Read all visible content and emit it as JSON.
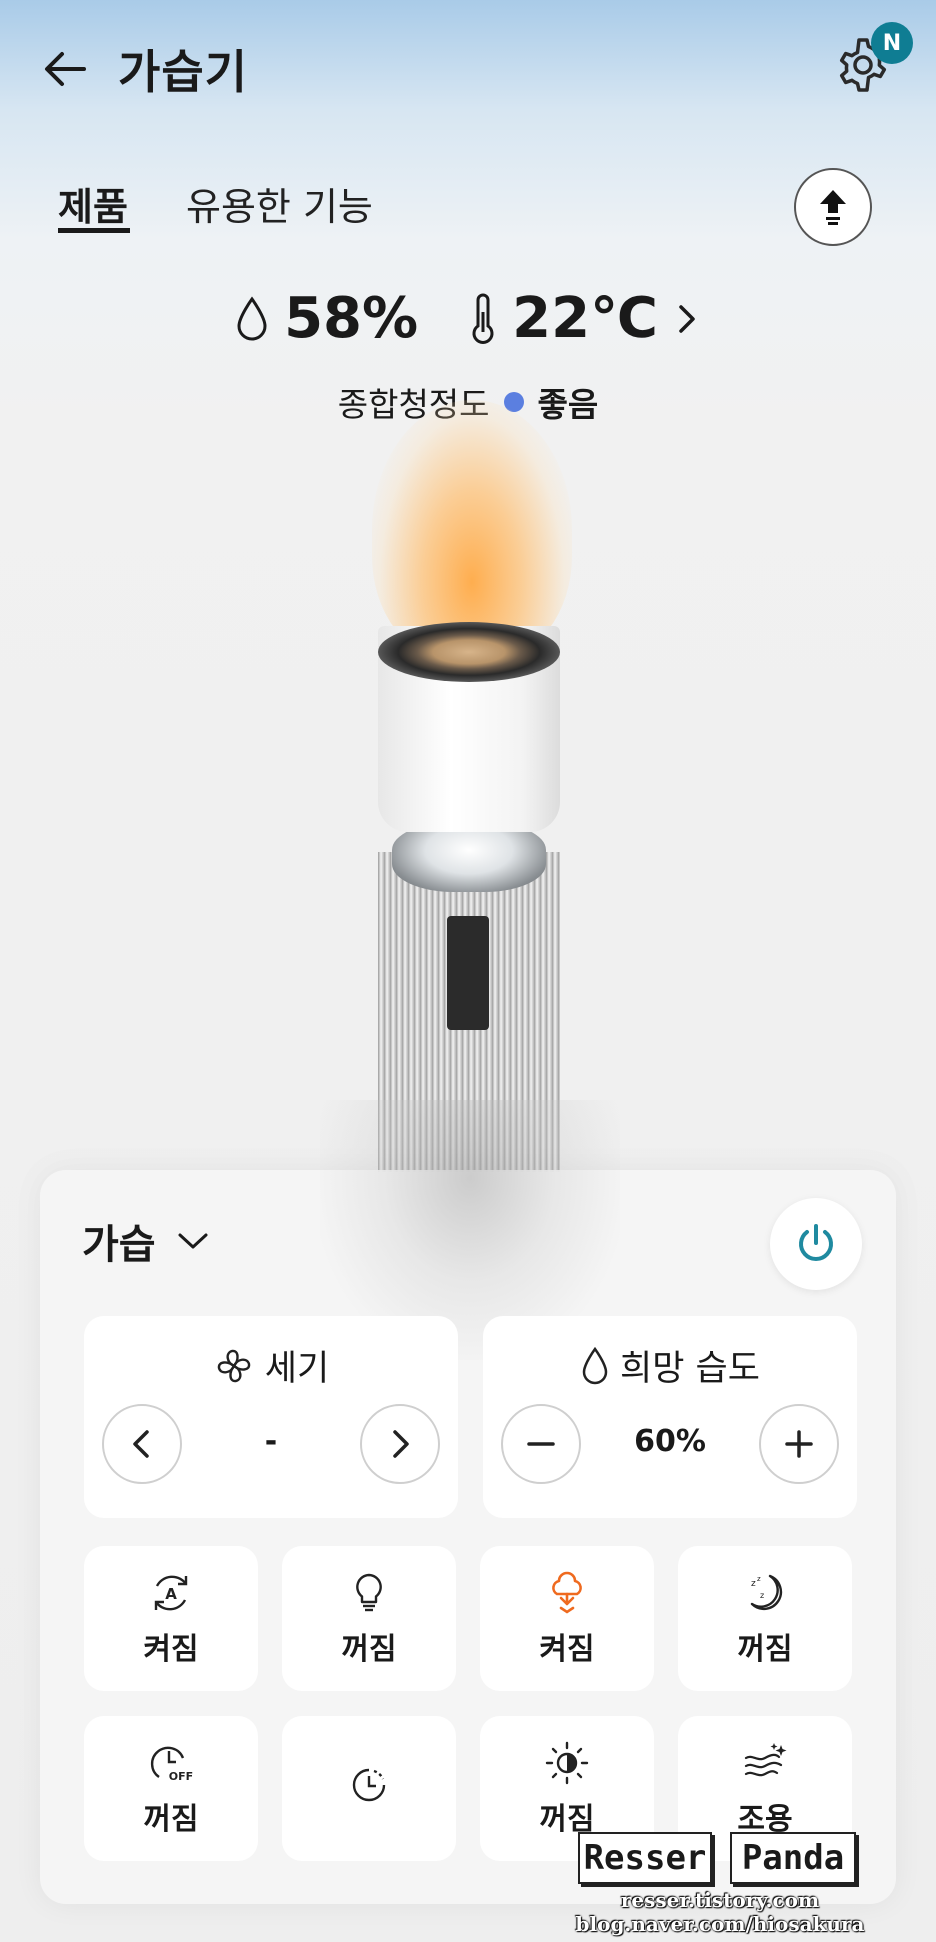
{
  "header": {
    "title": "가습기",
    "badge": "N"
  },
  "tabs": [
    {
      "label": "제품"
    },
    {
      "label": "유용한 기능"
    }
  ],
  "status": {
    "humidity": "58%",
    "temperature": "22℃",
    "air_quality_label": "종합청정도",
    "air_quality_value": "좋음",
    "air_quality_color": "#5b7fe0"
  },
  "panel": {
    "mode": "가습",
    "fan": {
      "label": "세기",
      "value": "-"
    },
    "target_humidity": {
      "label": "희망 습도",
      "value": "60%"
    },
    "tiles": [
      {
        "icon": "auto-mode-icon",
        "label": "켜짐"
      },
      {
        "icon": "light-bulb-icon",
        "label": "꺼짐"
      },
      {
        "icon": "mood-light-icon",
        "label": "켜짐"
      },
      {
        "icon": "sleep-mode-icon",
        "label": "꺼짐"
      },
      {
        "icon": "off-timer-icon",
        "label": "꺼짐"
      },
      {
        "icon": "timer-icon",
        "label": ""
      },
      {
        "icon": "brightness-icon",
        "label": "꺼짐"
      },
      {
        "icon": "quiet-wind-icon",
        "label": "조용"
      }
    ]
  },
  "accent_color": "#1f8aa0",
  "watermark": {
    "left_box": "Resser",
    "right_box": "Panda",
    "line1": "resser.tistory.com",
    "line2": "blog.naver.com/hiosakura"
  }
}
